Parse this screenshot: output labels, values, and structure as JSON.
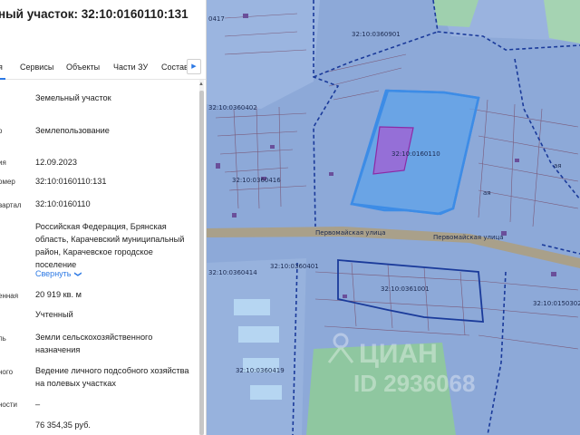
{
  "header": {
    "title": "ный участок: 32:10:0160110:131"
  },
  "tabs": [
    {
      "label": "я"
    },
    {
      "label": "Сервисы"
    },
    {
      "label": "Объекты"
    },
    {
      "label": "Части ЗУ"
    },
    {
      "label": "Состав"
    }
  ],
  "tabs_next_icon": "chevron-right-icon",
  "details": [
    {
      "label": "",
      "value": "Земельный участок"
    },
    {
      "label": "о",
      "value": "Землепользование"
    },
    {
      "label": "ия",
      "value": "12.09.2023"
    },
    {
      "label": "омер",
      "value": "32:10:0160110:131"
    },
    {
      "label": "вартал",
      "value": "32:10:0160110"
    },
    {
      "label": "",
      "value": "Российская Федерация, Брянская область, Карачевский муниципальный район, Карачевское городское поселение"
    },
    {
      "label": "енная",
      "value": "20 919 кв. м"
    },
    {
      "label": "",
      "value": "Учтенный"
    },
    {
      "label": "ль",
      "value": "Земли сельскохозяйственного назначения"
    },
    {
      "label": "ного",
      "value": "Ведение личного подсобного хозяйства на полевых участках"
    },
    {
      "label": "ности",
      "value": "–"
    },
    {
      "label": "",
      "value": "76 354,35 руб."
    }
  ],
  "collapse_link": "Свернуть",
  "map": {
    "labels": {
      "q0417": "0417",
      "q0901": "32:10:0360901",
      "q0402": "32:10:0360402",
      "q0416": "32:10:0360416",
      "q0110": "32:10:0160110",
      "q0414": "32:10:0360414",
      "q0401": "32:10:0360401",
      "q1001": "32:10:0361001",
      "q0302": "32:10:0150302",
      "q0419": "32:10:0360419",
      "street1": "Первомайская улица",
      "street2": "Первомайская улица",
      "parcel_small": "ая",
      "parcel_small2": "ая"
    },
    "watermark": "ЦИАН",
    "watermark_id": "ID 2936068",
    "colors": {
      "map_base": "#8da9d8",
      "selected_parcel": "#3d8ce6",
      "boundary": "#1a3a9a",
      "green": "#8fc7a0",
      "road": "#9a8f7a"
    }
  }
}
